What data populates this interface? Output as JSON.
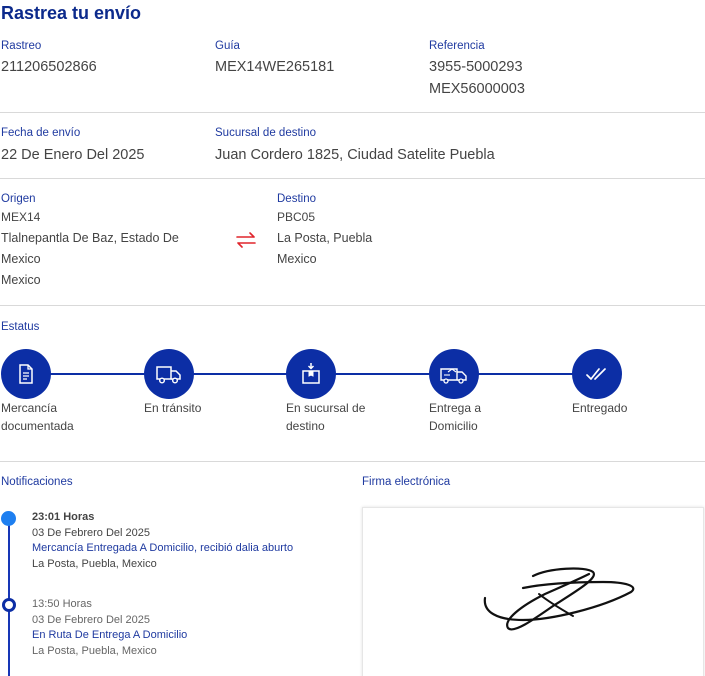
{
  "page_title": "Rastrea tu envío",
  "info": {
    "rastreo_label": "Rastreo",
    "rastreo_value": "211206502866",
    "guia_label": "Guía",
    "guia_value": "MEX14WE265181",
    "referencia_label": "Referencia",
    "referencia_values": [
      "3955-5000293",
      "MEX56000003"
    ],
    "fecha_label": "Fecha de envío",
    "fecha_value": "22 De Enero Del 2025",
    "sucursal_label": "Sucursal de destino",
    "sucursal_value": "Juan Cordero 1825, Ciudad Satelite Puebla"
  },
  "origin": {
    "label": "Origen",
    "code": "MEX14",
    "lines": [
      "Tlalnepantla De Baz, Estado De",
      "Mexico",
      "Mexico"
    ]
  },
  "destination": {
    "label": "Destino",
    "code": "PBC05",
    "lines": [
      "La Posta, Puebla",
      "Mexico"
    ]
  },
  "status": {
    "label": "Estatus",
    "steps": [
      {
        "icon": "document-icon",
        "lines": [
          "Mercancía",
          "documentada"
        ]
      },
      {
        "icon": "truck-icon",
        "lines": [
          "En tránsito"
        ]
      },
      {
        "icon": "package-icon",
        "lines": [
          "En sucursal de",
          "destino"
        ]
      },
      {
        "icon": "delivery-van-icon",
        "lines": [
          "Entrega a",
          "Domicilio"
        ]
      },
      {
        "icon": "double-check-icon",
        "lines": [
          "Entregado"
        ]
      }
    ]
  },
  "notifications": {
    "label": "Notificaciones",
    "items": [
      {
        "time": "23:01 Horas",
        "date": "03 De Febrero Del 2025",
        "event": "Mercancía Entregada A Domicilio, recibió dalia aburto",
        "place": "La Posta, Puebla, Mexico"
      },
      {
        "time": "13:50 Horas",
        "date": "03 De Febrero Del 2025",
        "event": "En Ruta De Entrega A Domicilio",
        "place": "La Posta, Puebla, Mexico"
      }
    ]
  },
  "signature": {
    "label": "Firma electrónica"
  },
  "colors": {
    "brand_blue": "#0c2ea5",
    "accent_red": "#e0252c",
    "timeline_dot": "#1e7ff0"
  }
}
